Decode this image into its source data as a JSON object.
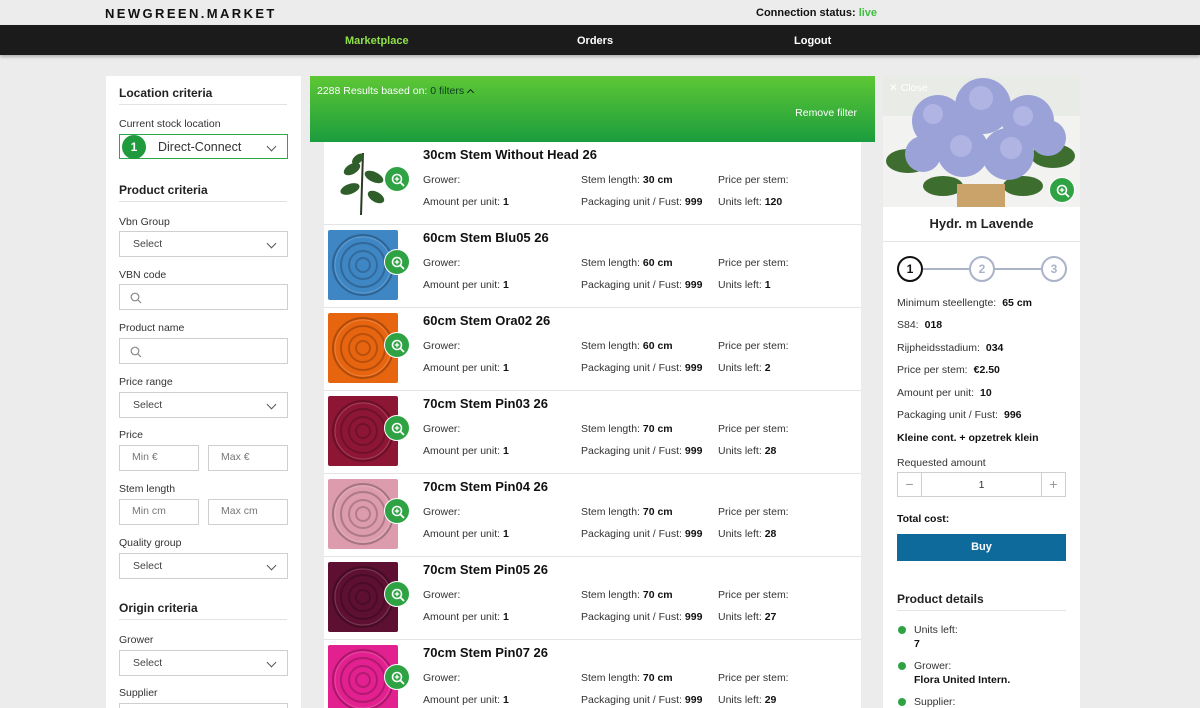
{
  "brand": "NEWGREEN.MARKET",
  "connection": {
    "label": "Connection status:",
    "status": "live"
  },
  "nav": {
    "marketplace": "Marketplace",
    "orders": "Orders",
    "logout": "Logout"
  },
  "sidebar": {
    "location_title": "Location criteria",
    "stock_label": "Current stock location",
    "stock_badge": "1",
    "stock_value": "Direct-Connect",
    "product_title": "Product criteria",
    "vbn_group_label": "Vbn Group",
    "vbn_group_value": "Select",
    "vbn_code_label": "VBN code",
    "product_name_label": "Product name",
    "price_range_label": "Price range",
    "price_range_value": "Select",
    "price_label": "Price",
    "price_min_placeholder": "Min €",
    "price_max_placeholder": "Max €",
    "stem_length_label": "Stem length",
    "stem_min_placeholder": "Min cm",
    "stem_max_placeholder": "Max cm",
    "quality_label": "Quality group",
    "quality_value": "Select",
    "origin_title": "Origin criteria",
    "grower_label": "Grower",
    "grower_value": "Select",
    "supplier_label": "Supplier"
  },
  "results": {
    "count_text": "2288 Results based on:",
    "filters_text": "0 filters",
    "remove_filter": "Remove filter"
  },
  "labels": {
    "grower": "Grower:",
    "stem_length": "Stem length:",
    "price_per_stem": "Price per stem:",
    "amount_per_unit": "Amount per unit:",
    "packaging": "Packaging unit / Fust:",
    "units_left": "Units left:"
  },
  "products": [
    {
      "name": "30cm Stem Without Head 26",
      "stem_length": "30 cm",
      "amount": "1",
      "packaging": "999",
      "units_left": "120",
      "image": "stem",
      "color": "#2f5e2a"
    },
    {
      "name": "60cm Stem Blu05 26",
      "stem_length": "60 cm",
      "amount": "1",
      "packaging": "999",
      "units_left": "1",
      "image": "rose",
      "color": "#3f86c4"
    },
    {
      "name": "60cm Stem Ora02 26",
      "stem_length": "60 cm",
      "amount": "1",
      "packaging": "999",
      "units_left": "2",
      "image": "rose",
      "color": "#e8650f"
    },
    {
      "name": "70cm Stem Pin03 26",
      "stem_length": "70 cm",
      "amount": "1",
      "packaging": "999",
      "units_left": "28",
      "image": "rose",
      "color": "#8e1635"
    },
    {
      "name": "70cm Stem Pin04 26",
      "stem_length": "70 cm",
      "amount": "1",
      "packaging": "999",
      "units_left": "28",
      "image": "rose",
      "color": "#dc9cae"
    },
    {
      "name": "70cm Stem Pin05 26",
      "stem_length": "70 cm",
      "amount": "1",
      "packaging": "999",
      "units_left": "27",
      "image": "rose",
      "color": "#5d1031"
    },
    {
      "name": "70cm Stem Pin07 26",
      "stem_length": "70 cm",
      "amount": "1",
      "packaging": "999",
      "units_left": "29",
      "image": "rose",
      "color": "#e2208f"
    }
  ],
  "detail": {
    "close": "✕ Close",
    "title": "Hydr. m Lavende",
    "steps": [
      "1",
      "2",
      "3"
    ],
    "min_length_label": "Minimum steellengte:",
    "min_length_value": "65 cm",
    "s84_label": "S84:",
    "s84_value": "018",
    "ripeness_label": "Rijpheidsstadium:",
    "ripeness_value": "034",
    "price_label": "Price per stem:",
    "price_value": "€2.50",
    "amount_label": "Amount per unit:",
    "amount_value": "10",
    "packaging_label": "Packaging unit / Fust:",
    "packaging_value": "996",
    "container_text": "Kleine cont. + opzetrek klein",
    "requested_label": "Requested amount",
    "requested_value": "1",
    "minus": "−",
    "plus": "+",
    "total_label": "Total cost:",
    "buy": "Buy",
    "details_title": "Product details",
    "units_left_label": "Units left:",
    "units_left_value": "7",
    "grower_label": "Grower:",
    "grower_value": "Flora United Intern.",
    "supplier_label": "Supplier:"
  },
  "colors": {
    "brand_green": "#1b9d3e",
    "accent_green": "#8fe04b",
    "buy_blue": "#0f6a9c"
  },
  "icons": [
    "search-icon",
    "chevron-down-icon",
    "chevron-up-icon",
    "zoom-in-icon",
    "close-icon",
    "plus-icon",
    "minus-icon"
  ]
}
